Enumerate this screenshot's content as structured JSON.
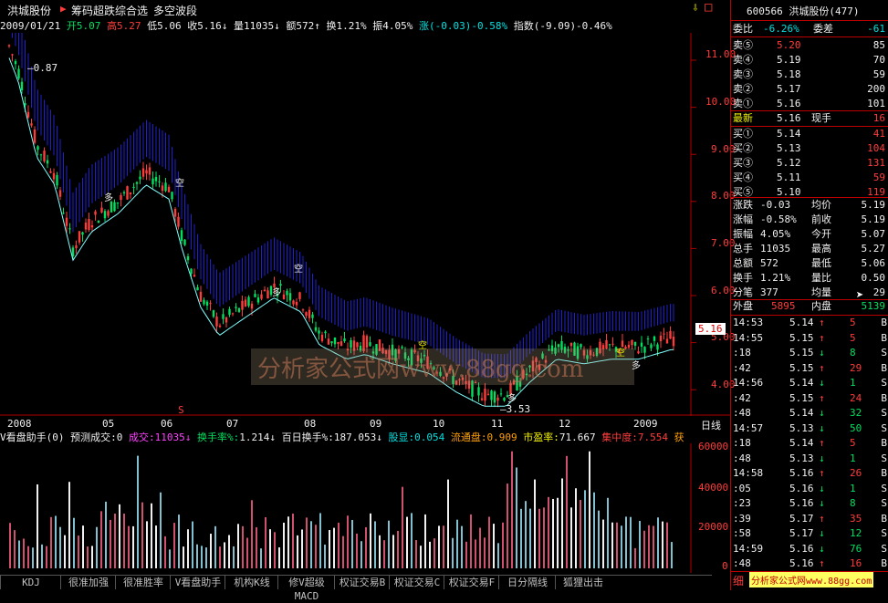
{
  "header": {
    "stock_name": "洪城股份",
    "pointer": "▶",
    "formula1": "筹码超跌综合选",
    "formula2": "多空波段",
    "lock_icon": "⇩",
    "corner_box": "□"
  },
  "info_bar": {
    "date": "2009/01/21",
    "open_label": "开",
    "open": "5.07",
    "high_label": "高",
    "high": "5.27",
    "low_label": "低",
    "low": "5.06",
    "close_label": "收",
    "close": "5.16",
    "volume_label": "量",
    "volume": "11035",
    "amount_label": "额",
    "amount": "572",
    "turnover_label": "换",
    "turnover": "1.21%",
    "amplitude_label": "振",
    "amplitude": "4.05%",
    "change_label": "涨",
    "change": "(-0.03)-0.58%",
    "index_label": "指数",
    "index": "(-9.09)-0.46%"
  },
  "chart_annotations": {
    "high_value": "0.87",
    "low_value": "3.53",
    "current_tag": "5.16",
    "marker_kong": "空",
    "marker_duo": "多",
    "marker_s": "S",
    "marker_dot": "⊕"
  },
  "price_axis": [
    "11.00",
    "10.00",
    "9.00",
    "8.00",
    "7.00",
    "6.00",
    "5.00",
    "4.00"
  ],
  "time_axis": [
    "2008",
    "05",
    "06",
    "07",
    "08",
    "09",
    "10",
    "11",
    "12",
    "2009"
  ],
  "time_axis_right": "日线",
  "volume_bar": {
    "title": "V看盘助手(0)",
    "predict_label": "预测成交:0",
    "volume_label": "成交:",
    "volume": "11035",
    "turnover_label": "换手率%:",
    "turnover": "1.214",
    "hundred_label": "百日换手%:",
    "hundred": "187.053",
    "shares_label": "股显:",
    "shares": "0.054",
    "float_label": "流通盘:",
    "float": "0.909",
    "pe_label": "市盈率:",
    "pe": "71.667",
    "concentration_label": "集中度:",
    "concentration": "7.554",
    "more": "获"
  },
  "volume_axis": [
    "60000",
    "40000",
    "20000",
    "0"
  ],
  "tabs": [
    "KDJ",
    "很准加强",
    "很准胜率",
    "V看盘助手",
    "机构K线",
    "修V超级MACD",
    "权证交易B",
    "权证交易C",
    "权证交易F",
    "日分隔线",
    "狐狸出击"
  ],
  "quote_panel": {
    "code": "600566",
    "name": "洪城股份",
    "count": "(477)",
    "weibi_label": "委比",
    "weibi": "-6.26%",
    "weicha_label": "委差",
    "weicha": "-61",
    "asks": [
      {
        "label": "卖⑤",
        "price": "5.20",
        "vol": "85"
      },
      {
        "label": "卖④",
        "price": "5.19",
        "vol": "70"
      },
      {
        "label": "卖③",
        "price": "5.18",
        "vol": "59"
      },
      {
        "label": "卖②",
        "price": "5.17",
        "vol": "200"
      },
      {
        "label": "卖①",
        "price": "5.16",
        "vol": "101"
      }
    ],
    "latest_label": "最新",
    "latest": "5.16",
    "hand_label": "现手",
    "hand": "16",
    "bids": [
      {
        "label": "买①",
        "price": "5.14",
        "vol": "41"
      },
      {
        "label": "买②",
        "price": "5.13",
        "vol": "104"
      },
      {
        "label": "买③",
        "price": "5.12",
        "vol": "131"
      },
      {
        "label": "买④",
        "price": "5.11",
        "vol": "59"
      },
      {
        "label": "买⑤",
        "price": "5.10",
        "vol": "119"
      }
    ],
    "stats": [
      {
        "l1": "涨跌",
        "v1": "-0.03",
        "l2": "均价",
        "v2": "5.19"
      },
      {
        "l1": "涨幅",
        "v1": "-0.58%",
        "l2": "前收",
        "v2": "5.19"
      },
      {
        "l1": "振幅",
        "v1": "4.05%",
        "l2": "今开",
        "v2": "5.07"
      },
      {
        "l1": "总手",
        "v1": "11035",
        "l2": "最高",
        "v2": "5.27"
      },
      {
        "l1": "总额",
        "v1": "572",
        "l2": "最低",
        "v2": "5.06"
      },
      {
        "l1": "换手",
        "v1": "1.21%",
        "l2": "量比",
        "v2": "0.50"
      },
      {
        "l1": "分笔",
        "v1": "377",
        "l2": "均量",
        "v2": "29"
      }
    ],
    "outer_label": "外盘",
    "outer": "5895",
    "inner_label": "内盘",
    "inner": "5139",
    "ticks": [
      {
        "t": "14:53",
        "p": "5.14",
        "d": "↑",
        "v": "5",
        "s": "B"
      },
      {
        "t": "14:55",
        "p": "5.15",
        "d": "↑",
        "v": "5",
        "s": "B"
      },
      {
        "t": ":18",
        "p": "5.15",
        "d": "↓",
        "v": "8",
        "s": "S"
      },
      {
        "t": ":42",
        "p": "5.15",
        "d": "↑",
        "v": "29",
        "s": "B"
      },
      {
        "t": "14:56",
        "p": "5.14",
        "d": "↓",
        "v": "1",
        "s": "S"
      },
      {
        "t": ":42",
        "p": "5.15",
        "d": "↑",
        "v": "24",
        "s": "B"
      },
      {
        "t": ":48",
        "p": "5.14",
        "d": "↓",
        "v": "32",
        "s": "S"
      },
      {
        "t": "14:57",
        "p": "5.13",
        "d": "↓",
        "v": "50",
        "s": "S"
      },
      {
        "t": ":18",
        "p": "5.14",
        "d": "↑",
        "v": "5",
        "s": "B"
      },
      {
        "t": ":48",
        "p": "5.13",
        "d": "↓",
        "v": "1",
        "s": "S"
      },
      {
        "t": "14:58",
        "p": "5.16",
        "d": "↑",
        "v": "26",
        "s": "B"
      },
      {
        "t": ":05",
        "p": "5.16",
        "d": "↓",
        "v": "1",
        "s": "S"
      },
      {
        "t": ":23",
        "p": "5.16",
        "d": "↓",
        "v": "8",
        "s": "S"
      },
      {
        "t": ":39",
        "p": "5.17",
        "d": "↑",
        "v": "35",
        "s": "B"
      },
      {
        "t": ":58",
        "p": "5.17",
        "d": "↓",
        "v": "12",
        "s": "S"
      },
      {
        "t": "14:59",
        "p": "5.16",
        "d": "↓",
        "v": "76",
        "s": "S"
      },
      {
        "t": ":48",
        "p": "5.16",
        "d": "↑",
        "v": "16",
        "s": "B"
      }
    ],
    "bottom_label": "细",
    "watermark": "分析家公式网www.88gg.com"
  },
  "colors": {
    "up": "#ff3c3c",
    "down": "#00e060",
    "bg": "#000000",
    "band": "#2020d0",
    "axis": "#b00000"
  }
}
